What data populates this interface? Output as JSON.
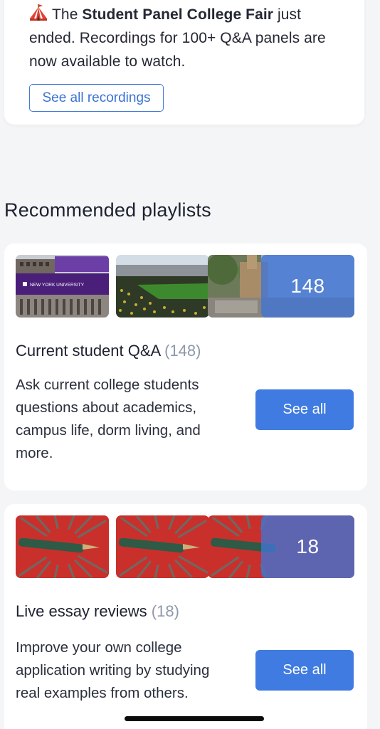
{
  "announcement": {
    "icon": "circus-tent-icon",
    "text_before": "The ",
    "event_name": "Student Panel College Fair",
    "text_after": " just ended. Recordings for 100+ Q&A panels are now available to watch.",
    "button_label": "See all recordings"
  },
  "section": {
    "title": "Recommended playlists"
  },
  "playlists": [
    {
      "title": "Current student Q&A",
      "count_label": "(148)",
      "overlay_count": "148",
      "description": "Ask current college students questions about academics, campus life, dorm living, and more.",
      "button_label": "See all",
      "thumb_caption": "NEW YORK UNIVERSITY"
    },
    {
      "title": "Live essay reviews",
      "count_label": "(18)",
      "overlay_count": "18",
      "description": "Improve your own college application writing by studying real examples from others.",
      "button_label": "See all"
    }
  ],
  "colors": {
    "accent": "#3f7be0",
    "overlay": "#4074d6",
    "muted_count": "#8d98ab",
    "background": "#f4f5f7"
  }
}
